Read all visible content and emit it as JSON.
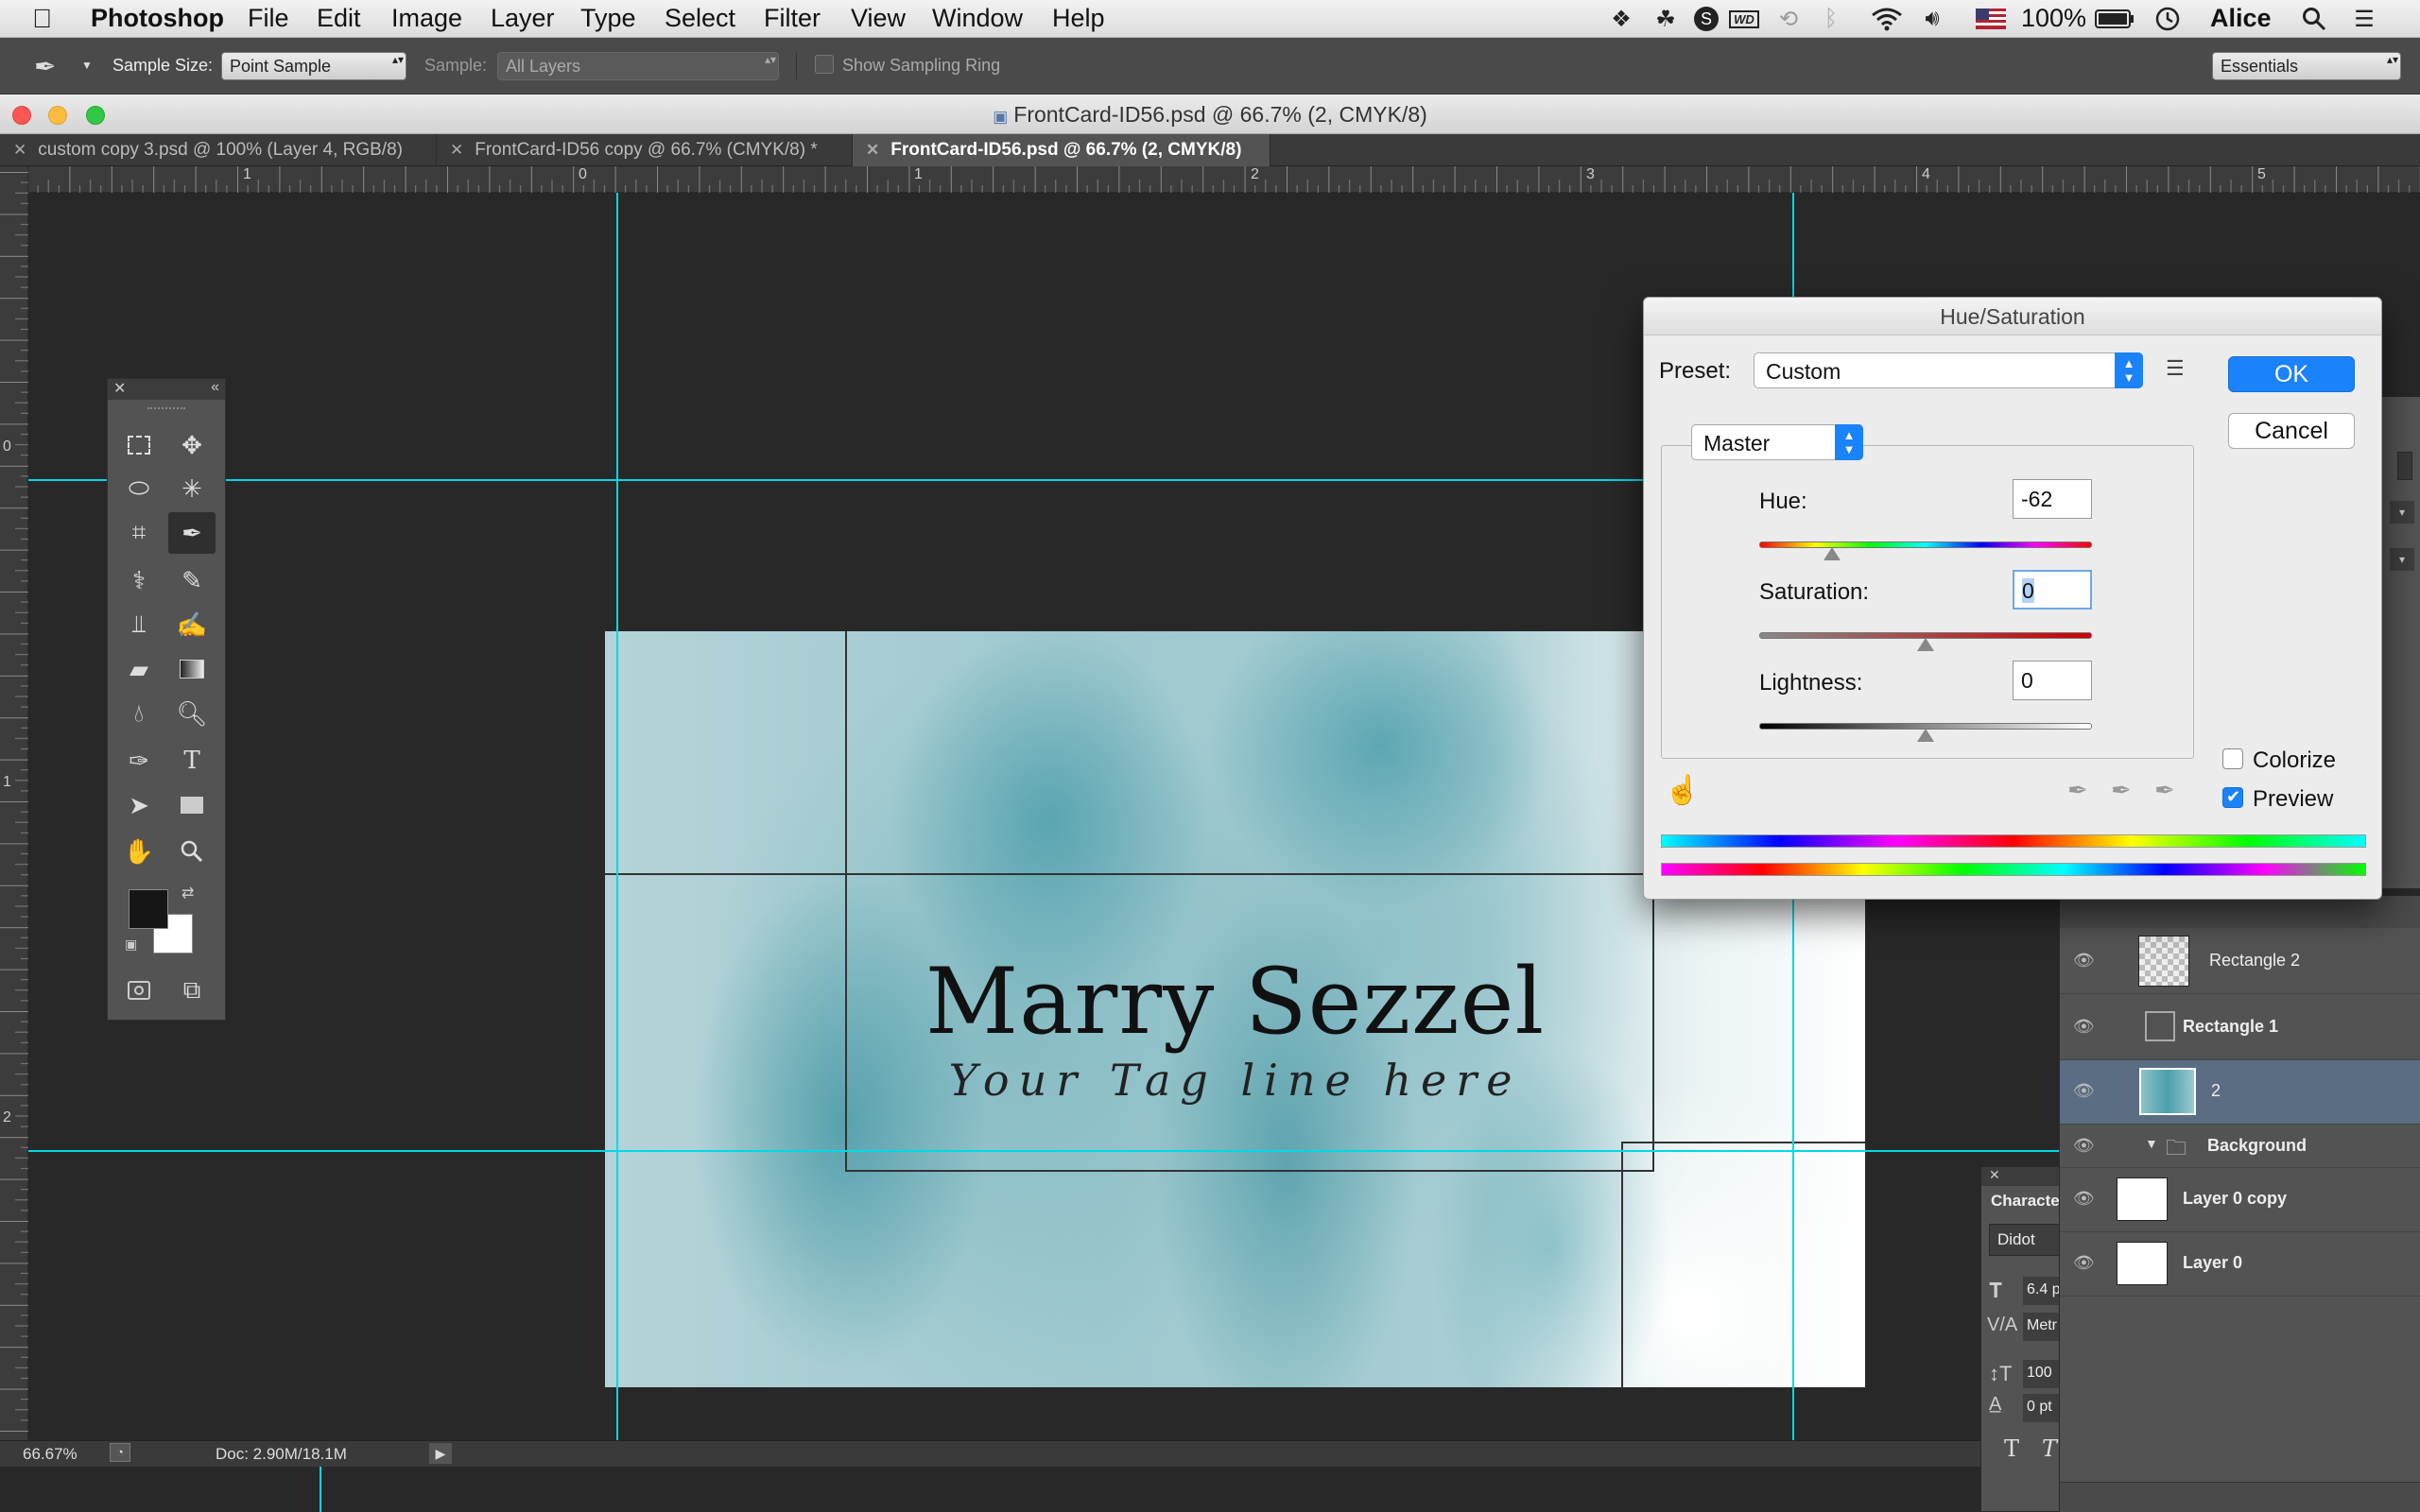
{
  "menubar": {
    "apple": "",
    "app": "Photoshop",
    "items": [
      "File",
      "Edit",
      "Image",
      "Layer",
      "Type",
      "Select",
      "Filter",
      "View",
      "Window",
      "Help"
    ],
    "status": {
      "battery": "100%",
      "user": "Alice",
      "wd": "WD"
    }
  },
  "options": {
    "sample_size_label": "Sample Size:",
    "sample_size_value": "Point Sample",
    "sample_label": "Sample:",
    "sample_value": "All Layers",
    "sampling_ring_label": "Show Sampling Ring",
    "workspace": "Essentials"
  },
  "window": {
    "title": "FrontCard-ID56.psd @ 66.7% (2, CMYK/8)"
  },
  "tabs": [
    {
      "label": "custom copy 3.psd @ 100% (Layer 4, RGB/8)"
    },
    {
      "label": "FrontCard-ID56 copy @ 66.7% (CMYK/8) *"
    },
    {
      "label": "FrontCard-ID56.psd @ 66.7% (2, CMYK/8)"
    }
  ],
  "ruler": {
    "h_labels": [
      "1",
      "0",
      "1",
      "2",
      "3",
      "4",
      "5"
    ],
    "v_labels": [
      "0",
      "1",
      "2"
    ]
  },
  "card": {
    "name": "Marry Sezzel",
    "tagline": "Your Tag line here"
  },
  "status": {
    "zoom": "66.67%",
    "doc": "Doc: 2.90M/18.1M"
  },
  "layers": [
    {
      "name": "Rectangle 2"
    },
    {
      "name": "Rectangle 1"
    },
    {
      "name": "2"
    },
    {
      "name": "Background"
    },
    {
      "name": "Layer 0 copy"
    },
    {
      "name": "Layer 0"
    }
  ],
  "character": {
    "title": "Characte",
    "font": "Didot",
    "size": "6.4 p",
    "kerning": "Metr",
    "scale": "100",
    "baseline": "0 pt"
  },
  "dialog": {
    "title": "Hue/Saturation",
    "preset_label": "Preset:",
    "preset_value": "Custom",
    "channel": "Master",
    "ok": "OK",
    "cancel": "Cancel",
    "hue_label": "Hue:",
    "hue_value": "-62",
    "saturation_label": "Saturation:",
    "saturation_value": "0",
    "lightness_label": "Lightness:",
    "lightness_value": "0",
    "colorize_label": "Colorize",
    "colorize_checked": false,
    "preview_label": "Preview",
    "preview_checked": true,
    "hue_fraction": 0.22,
    "saturation_fraction": 0.5,
    "lightness_fraction": 0.5
  },
  "colors": {
    "guide": "#00d8e6",
    "ok_button": "#1a82fb",
    "selected_layer": "#5b6d82",
    "teal": "#1e8c98"
  }
}
